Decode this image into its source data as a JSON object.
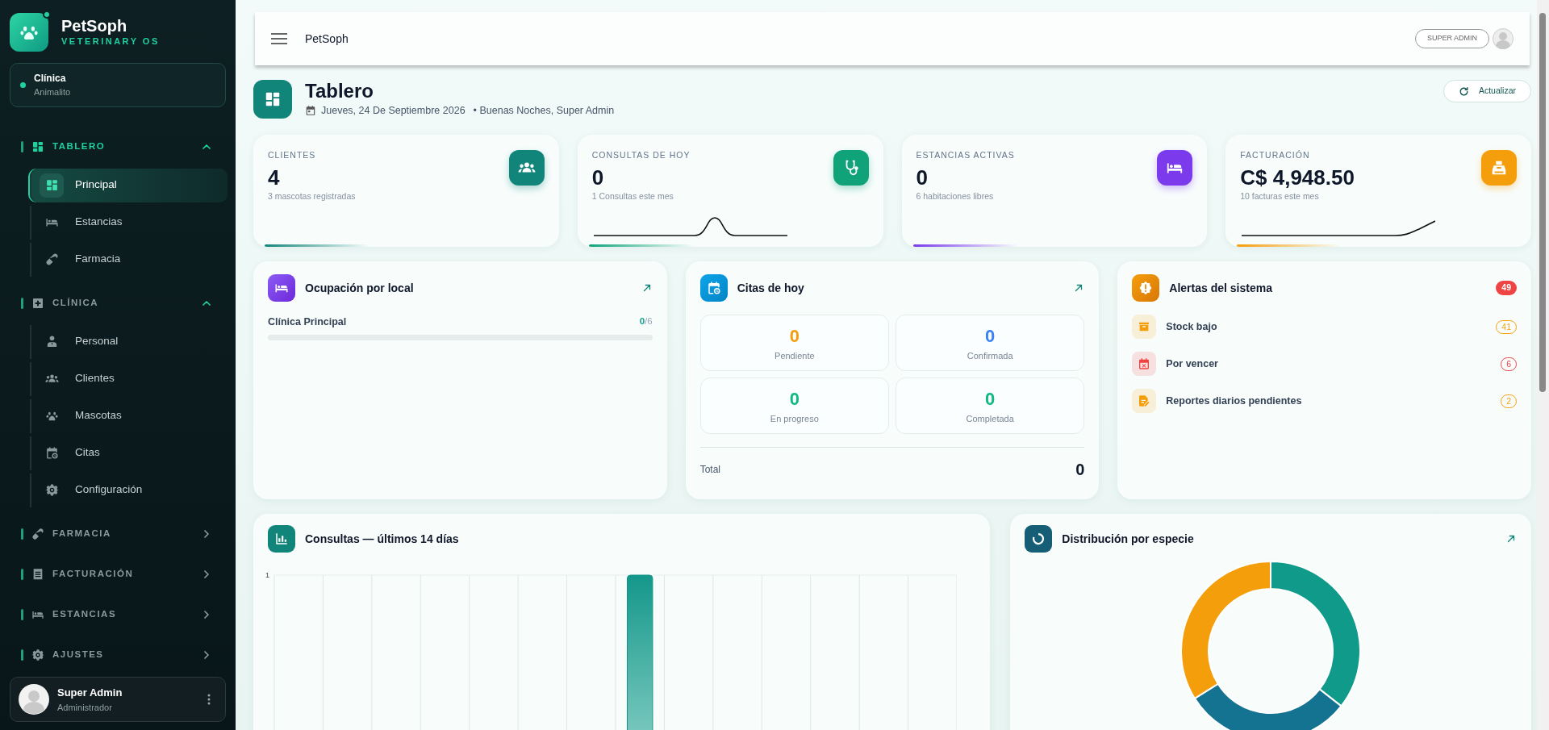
{
  "sidebar": {
    "brand": {
      "name": "PetSoph",
      "tagline": "VETERINARY OS",
      "online": true
    },
    "clinic": {
      "label": "Clínica",
      "name": "Animalito"
    },
    "groups": [
      {
        "label": "TABLERO",
        "expanded": true,
        "children": [
          {
            "label": "Principal",
            "selected": true
          },
          {
            "label": "Estancias",
            "selected": false
          },
          {
            "label": "Farmacia",
            "selected": false
          }
        ]
      },
      {
        "label": "CLÍNICA",
        "expanded": true,
        "children": [
          {
            "label": "Personal",
            "selected": false
          },
          {
            "label": "Clientes",
            "selected": false
          },
          {
            "label": "Mascotas",
            "selected": false
          },
          {
            "label": "Citas",
            "selected": false
          },
          {
            "label": "Configuración",
            "selected": false
          }
        ]
      },
      {
        "label": "FARMACIA",
        "expanded": false
      },
      {
        "label": "FACTURACIÓN",
        "expanded": false
      },
      {
        "label": "ESTANCIAS",
        "expanded": false
      },
      {
        "label": "AJUSTES",
        "expanded": false
      }
    ],
    "user": {
      "name": "Super Admin",
      "role": "Administrador"
    }
  },
  "topbar": {
    "title": "PetSoph",
    "role_badge": "SUPER ADMIN"
  },
  "page": {
    "title": "Tablero",
    "date": "Jueves, 24 De Septiembre 2026",
    "greeting": "• Buenas Noches, Super Admin",
    "refresh_button": "Actualizar"
  },
  "stats": [
    {
      "kind": "plain",
      "label": "CLIENTES",
      "value": "4",
      "note": "3 mascotas registradas",
      "color": "#12857a"
    },
    {
      "kind": "peak",
      "label": "CONSULTAS DE HOY",
      "value": "0",
      "note": "1 Consultas este mes",
      "color": "#10a37a"
    },
    {
      "kind": "plain",
      "label": "ESTANCIAS ACTIVAS",
      "value": "0",
      "note": "6 habitaciones libres",
      "color": "#7c3aed"
    },
    {
      "kind": "rise",
      "label": "FACTURACIÓN",
      "value": "C$ 4,948.50",
      "note": "10 facturas este mes",
      "color": "#f59e0b"
    }
  ],
  "occupancy": {
    "title": "Ocupación por local",
    "locations": [
      {
        "name": "Clínica Principal",
        "occupied": "0",
        "capacity": "/6",
        "level": 0
      }
    ]
  },
  "appointments": {
    "title": "Citas de hoy",
    "statuses": [
      {
        "count": "0",
        "label": "Pendiente",
        "color": "#f59e0b"
      },
      {
        "count": "0",
        "label": "Confirmada",
        "color": "#3b82f6"
      },
      {
        "count": "0",
        "label": "En progreso",
        "color": "#10b981"
      },
      {
        "count": "0",
        "label": "Completada",
        "color": "#10b981"
      }
    ],
    "total_label": "Total",
    "total": "0"
  },
  "alerts": {
    "title": "Alertas del sistema",
    "count": "49",
    "items": [
      {
        "label": "Stock bajo",
        "count": "41",
        "color": "#f59e0b"
      },
      {
        "label": "Por vencer",
        "count": "6",
        "color": "#ef4444"
      },
      {
        "label": "Reportes diarios pendientes",
        "count": "2",
        "color": "#f59e0b"
      }
    ]
  },
  "consultations": {
    "title": "Consultas — últimos 14 días",
    "axis_label": "1"
  },
  "species": {
    "title": "Distribución por especie"
  }
}
